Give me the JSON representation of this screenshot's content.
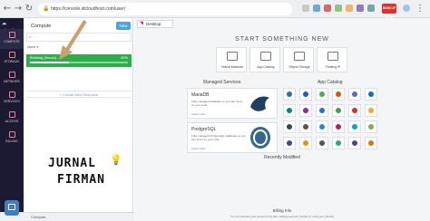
{
  "browser": {
    "url": "https://console.idcloudhost.com/user/",
    "signup_label": "SIGN UP NOW"
  },
  "sidebar": {
    "logo": "CloudHost",
    "items": [
      {
        "label": "COMPUTE",
        "icon": "compute-icon"
      },
      {
        "label": "STORAGE",
        "icon": "storage-icon"
      },
      {
        "label": "NETWORK",
        "icon": "network-icon"
      },
      {
        "label": "SERVICES",
        "icon": "services-icon"
      },
      {
        "label": "ACCESS",
        "icon": "access-icon"
      },
      {
        "label": "BILLING",
        "icon": "billing-icon"
      }
    ]
  },
  "compute": {
    "title": "Compute",
    "new_label": "New",
    "filter_label": "Name",
    "item_name": "Building (firman)...",
    "item_percent": "40%",
    "item_progress": 0.4,
    "add_resource_label": "+ Create New Resource"
  },
  "watermark": {
    "line1": "JURNAL",
    "line2": "FIRMAN"
  },
  "bottom": {
    "label": "Compute"
  },
  "desktop": {
    "tab_label": "Desktop",
    "start_title": "START SOMETHING NEW",
    "cards": [
      "Virtual Machine",
      "App Catalog",
      "Object Storage",
      "Floating IP"
    ],
    "managed_title": "Managed Services",
    "catalog_title": "App Catalog",
    "services": [
      {
        "name": "MariaDB",
        "desc": "Fully managed database so you can focus on your code",
        "link": "Learn more"
      },
      {
        "name": "PostgreSQL",
        "desc": "Fully managed PostgreSQL database so you can focus on your code",
        "link": "Learn more"
      }
    ],
    "recent_title": "Recently Modified",
    "billing_title": "Billing Info",
    "billing_sub": "You can activate your account only after adding payment method to verify your identity"
  },
  "colors": {
    "sidebar": "#1c1a33",
    "accent": "#4aa3df",
    "progress": "#2eae4b",
    "arrow": "#c9a16a"
  }
}
